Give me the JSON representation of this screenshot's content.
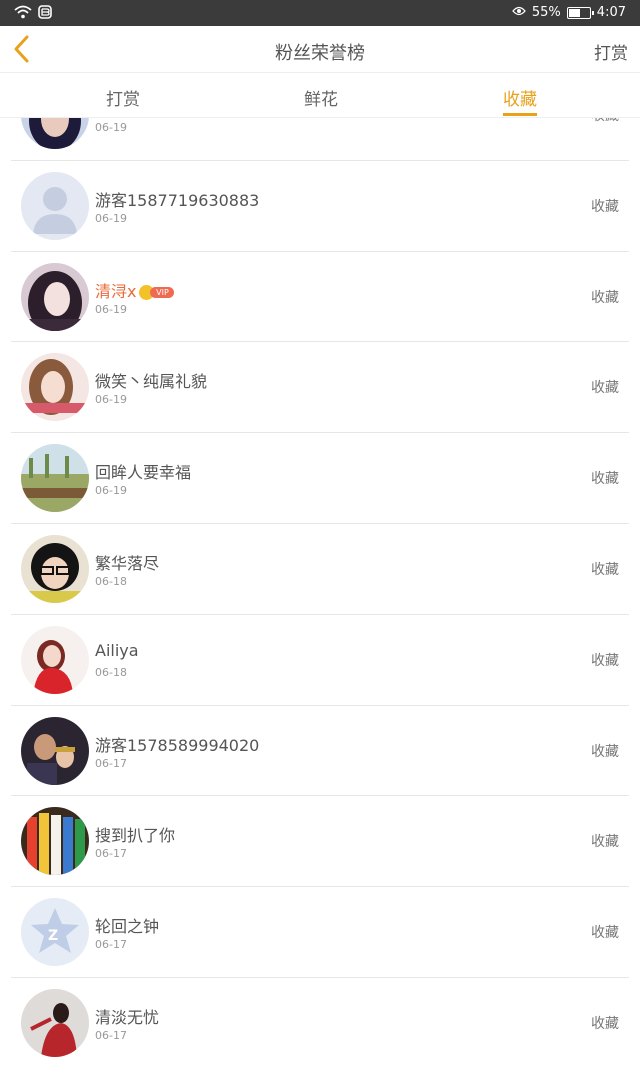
{
  "status_bar": {
    "battery": "55%",
    "time": "4:07"
  },
  "header": {
    "title": "粉丝荣誉榜",
    "right_action": "打赏"
  },
  "tabs": [
    {
      "label": "打赏"
    },
    {
      "label": "鲜花"
    },
    {
      "label": "收藏",
      "active": true
    }
  ],
  "accent_color": "#e9a11c",
  "list": [
    {
      "name": "",
      "date": "06-19",
      "action": "收藏",
      "avatar": "dark-hair"
    },
    {
      "name": "游客1587719630883",
      "date": "06-19",
      "action": "收藏",
      "avatar": "default"
    },
    {
      "name": "清浔x",
      "date": "06-19",
      "action": "收藏",
      "vip": true,
      "vip_label": "VIP",
      "avatar": "girl"
    },
    {
      "name": "微笑丶纯属礼貌",
      "date": "06-19",
      "action": "收藏",
      "avatar": "girl-pink"
    },
    {
      "name": "回眸人要幸福",
      "date": "06-19",
      "action": "收藏",
      "avatar": "landscape"
    },
    {
      "name": "繁华落尽",
      "date": "06-18",
      "action": "收藏",
      "avatar": "glasses"
    },
    {
      "name": "Ailiya",
      "date": "06-18",
      "action": "收藏",
      "avatar": "red-girl"
    },
    {
      "name": "游客1578589994020",
      "date": "06-17",
      "action": "收藏",
      "avatar": "people"
    },
    {
      "name": "搜到扒了你",
      "date": "06-17",
      "action": "收藏",
      "avatar": "pencils"
    },
    {
      "name": "轮回之钟",
      "date": "06-17",
      "action": "收藏",
      "avatar": "qzone"
    },
    {
      "name": "清淡无忧",
      "date": "06-17",
      "action": "收藏",
      "avatar": "red-dress"
    }
  ]
}
